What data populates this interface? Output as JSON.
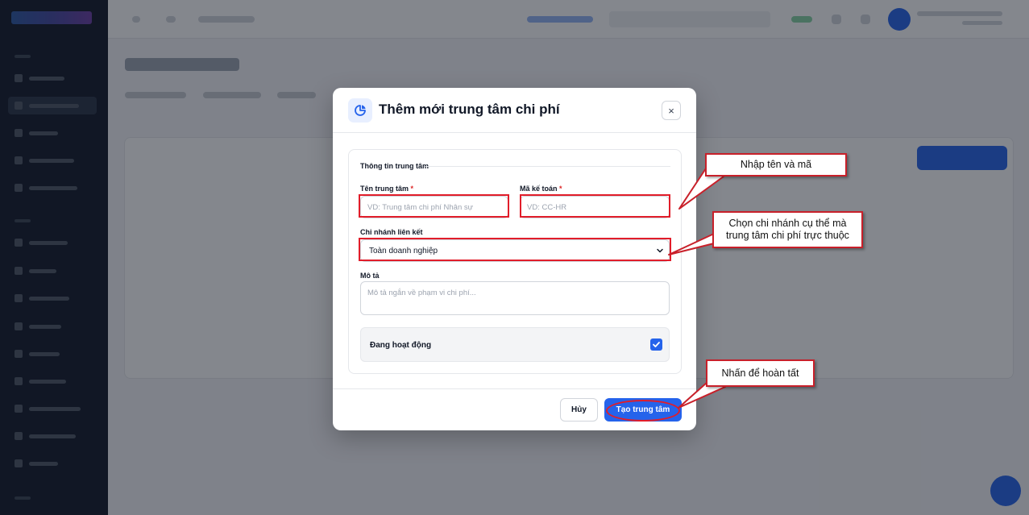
{
  "modal": {
    "title": "Thêm mới trung tâm chi phí",
    "close_symbol": "×",
    "section_title": "Thông tin trung tâm",
    "name_label": "Tên trung tâm",
    "name_placeholder": "VD: Trung tâm chi phí Nhân sự",
    "code_label": "Mã kế toán",
    "code_placeholder": "VD: CC-HR",
    "required_mark": "*",
    "branch_label": "Chi nhánh liên kết",
    "branch_value": "Toàn doanh nghiệp",
    "desc_label": "Mô tả",
    "desc_placeholder": "Mô tả ngắn về phạm vi chi phí...",
    "active_label": "Đang hoạt động",
    "active_checked": true,
    "cancel_label": "Hủy",
    "create_label": "Tạo trung tâm"
  },
  "annotations": {
    "name_code_note": "Nhập tên và mã",
    "branch_note_line1": "Chọn chi nhánh cụ thể mà",
    "branch_note_line2": "trung tâm chi phí trực thuộc",
    "finish_note": "Nhấn để hoàn tất"
  },
  "colors": {
    "primary": "#2563eb",
    "highlight": "#e11d2a"
  },
  "icons": {
    "modal_icon": "pie-chart-icon",
    "close": "close-icon",
    "select": "chevron-down-icon",
    "checkbox": "check-icon"
  }
}
